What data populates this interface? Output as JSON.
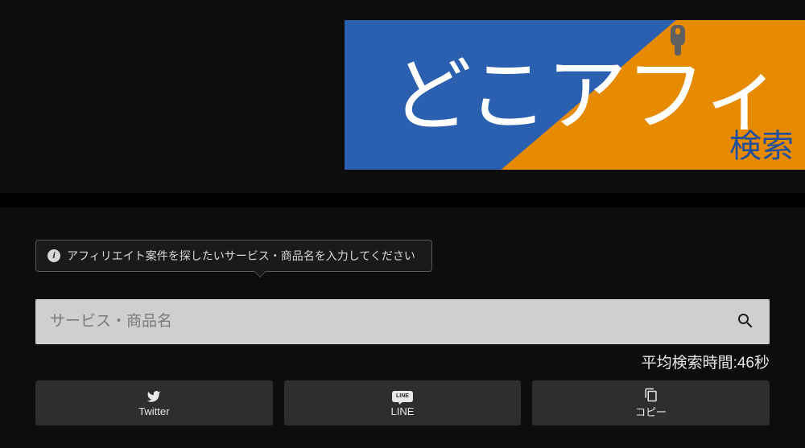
{
  "banner": {
    "title": "どこアフィ",
    "subtitle": "検索"
  },
  "tooltip": {
    "text": "アフィリエイト案件を探したいサービス・商品名を入力してください"
  },
  "search": {
    "placeholder": "サービス・商品名",
    "value": ""
  },
  "avg_time": {
    "label_prefix": "平均検索時間:",
    "value": "46秒"
  },
  "share": {
    "twitter": "Twitter",
    "line": "LINE",
    "copy": "コピー"
  },
  "icons": {
    "info": "i",
    "line_badge": "LINE"
  },
  "colors": {
    "bg": "#0d0d0d",
    "banner_blue": "#2b5fb0",
    "banner_orange": "#e68a00",
    "input_bg": "#cfcfcf",
    "button_bg": "#2e2e2e"
  }
}
